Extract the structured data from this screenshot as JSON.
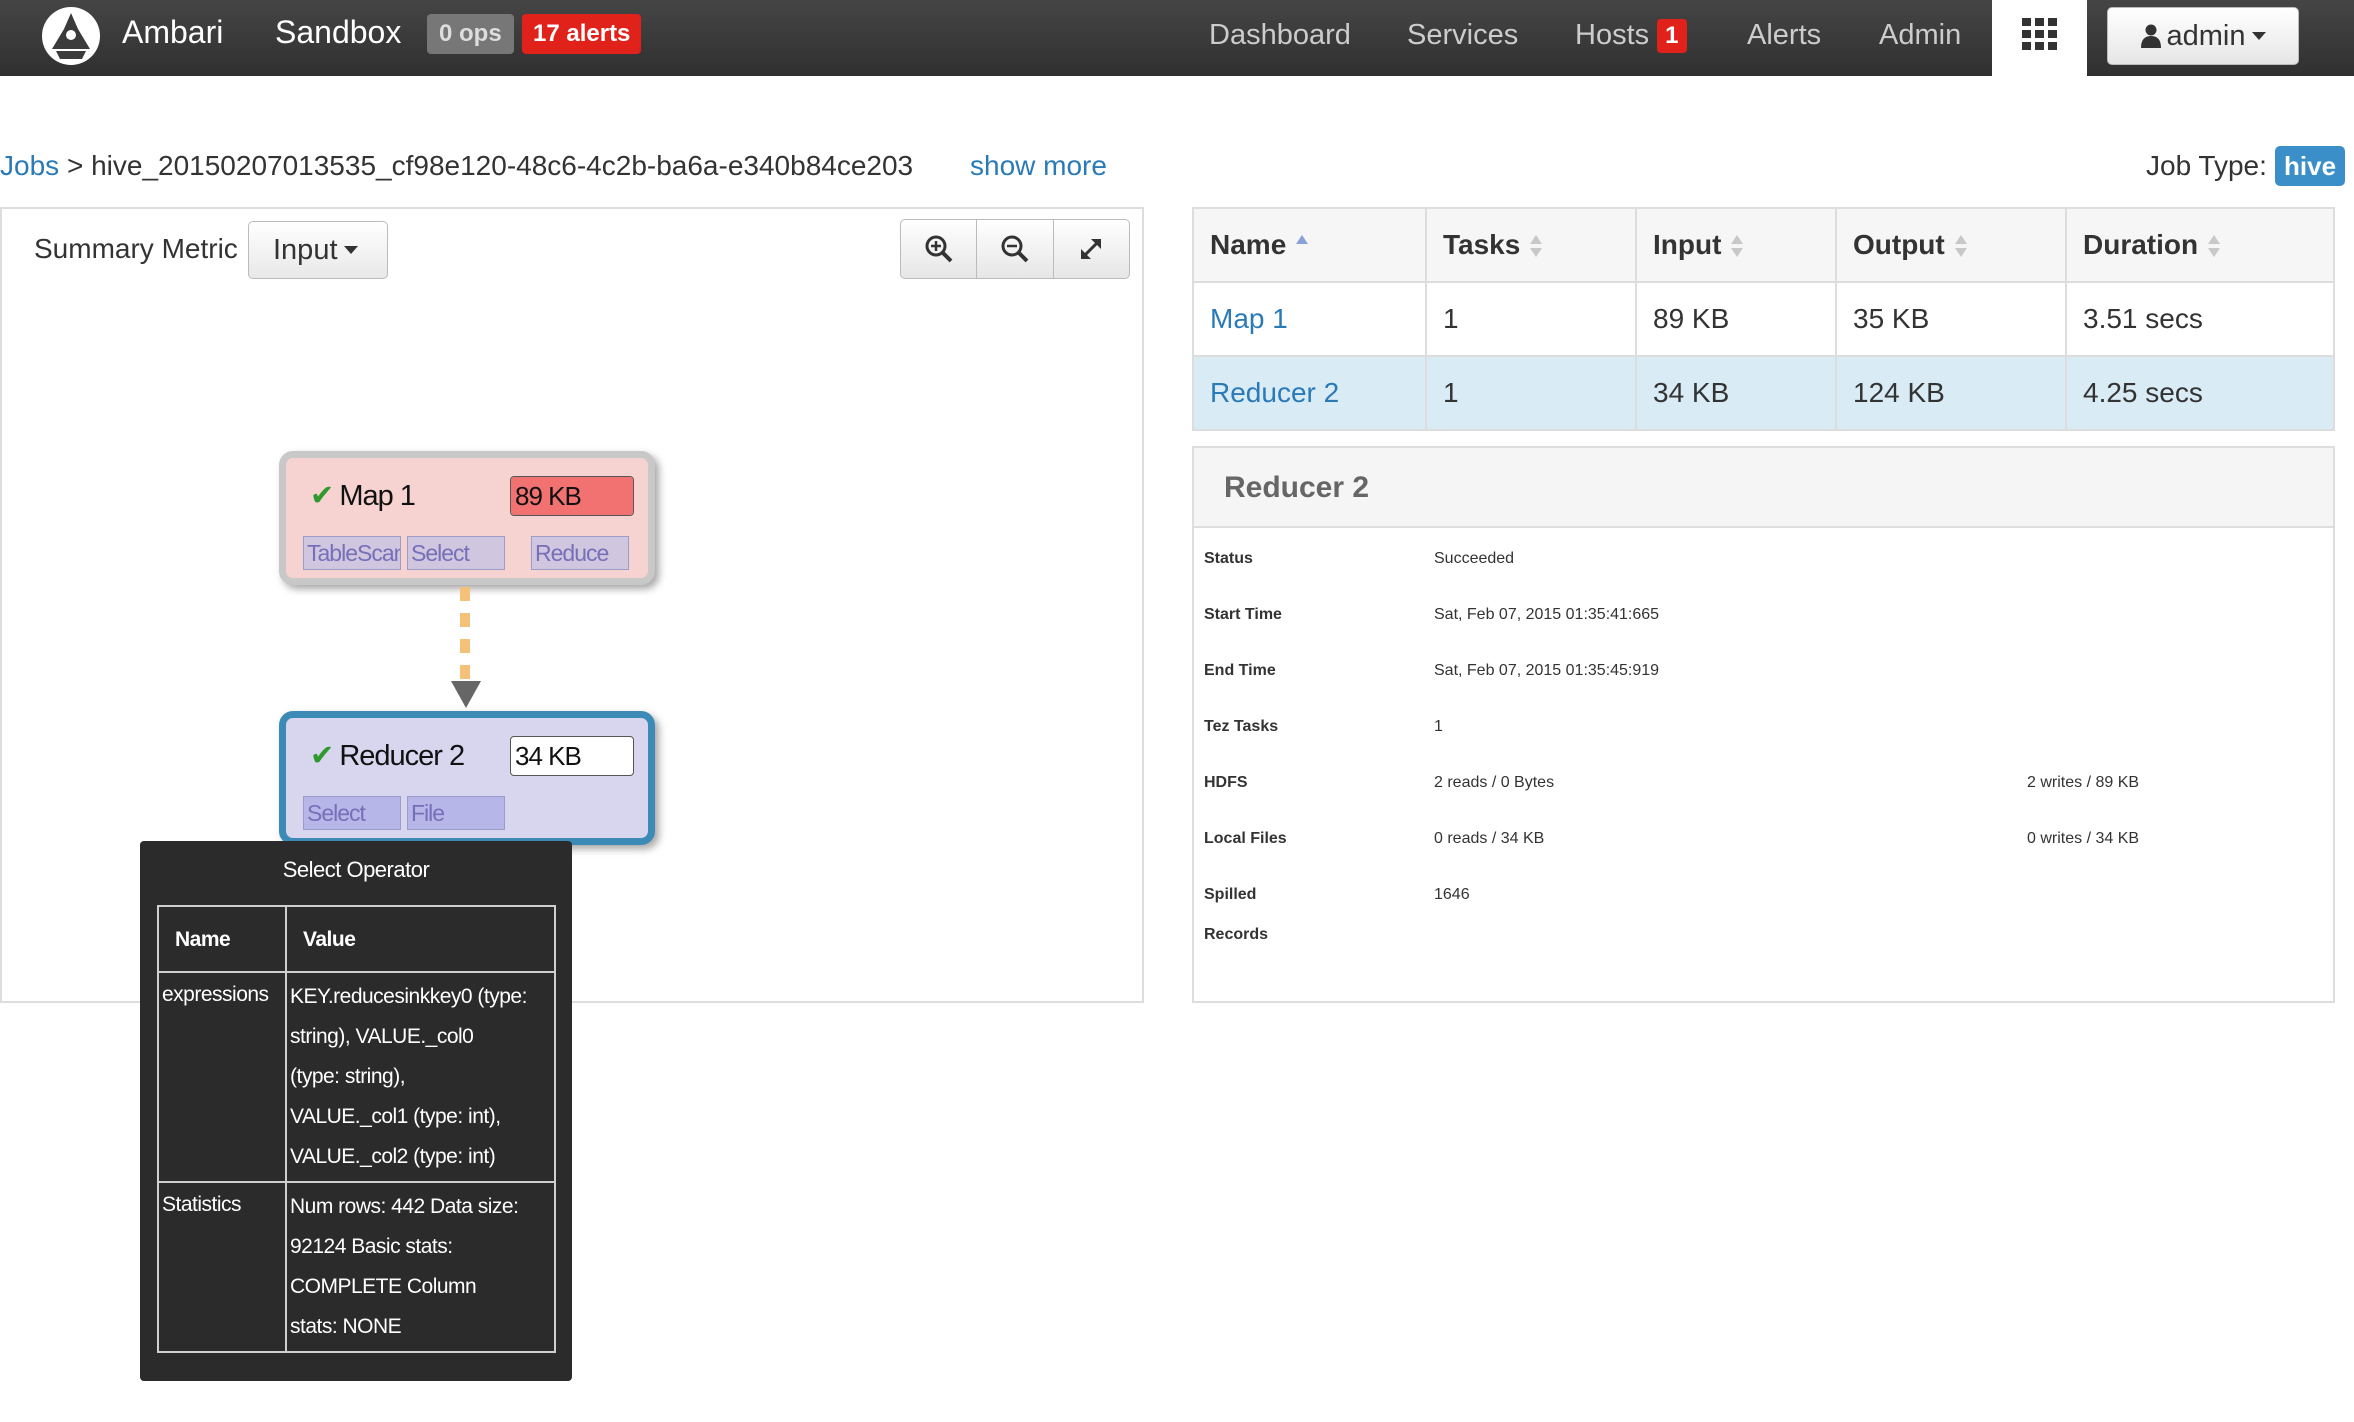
{
  "navbar": {
    "brand": "Ambari",
    "cluster": "Sandbox",
    "ops_badge": "0 ops",
    "alerts_badge": "17 alerts",
    "items": [
      {
        "label": "Dashboard"
      },
      {
        "label": "Services"
      },
      {
        "label": "Hosts",
        "badge": "1"
      },
      {
        "label": "Alerts"
      },
      {
        "label": "Admin"
      }
    ],
    "user_label": "admin",
    "icons": [
      "ambari-logo-icon",
      "apps-grid-icon",
      "user-icon",
      "caret-down-icon"
    ]
  },
  "breadcrumb": {
    "root": "Jobs",
    "separator": ">",
    "job_id": "hive_20150207013535_cf98e120-48c6-4c2b-ba6a-e340b84ce203",
    "show_more": "show more",
    "job_type_label": "Job Type:",
    "job_type": "hive"
  },
  "graph": {
    "summary_label": "Summary Metric",
    "metric_select": "Input",
    "toolbar_icons": [
      "zoom-in-icon",
      "zoom-out-icon",
      "expand-icon"
    ],
    "nodes": [
      {
        "name": "Map 1",
        "metric": "89 KB",
        "metric_fraction": 1.0,
        "operators": [
          "TableScan",
          "Select",
          "Reduce"
        ],
        "status_icon": "check-icon"
      },
      {
        "name": "Reducer 2",
        "metric": "34 KB",
        "metric_fraction": 0.0,
        "operators": [
          "Select",
          "File"
        ],
        "status_icon": "check-icon"
      }
    ],
    "colors": {
      "map_node": "#f6d2d0",
      "reducer_node": "#d8d6ee",
      "selected_border": "#3c8ab6",
      "edge": "#f5c078"
    }
  },
  "tooltip": {
    "title": "Select Operator",
    "headers": [
      "Name",
      "Value"
    ],
    "rows": [
      {
        "name": "expressions",
        "value_lines": [
          "KEY.reducesinkkey0 (type:",
          "string), VALUE._col0",
          "(type: string),",
          "VALUE._col1 (type: int),",
          "VALUE._col2 (type: int)"
        ]
      },
      {
        "name": "Statistics",
        "value_lines": [
          "Num rows: 442 Data size:",
          "92124 Basic stats:",
          "COMPLETE Column",
          "stats: NONE"
        ]
      }
    ]
  },
  "vertices": {
    "headers": [
      "Name",
      "Tasks",
      "Input",
      "Output",
      "Duration"
    ],
    "rows": [
      {
        "name": "Map 1",
        "tasks": "1",
        "input": "89 KB",
        "output": "35 KB",
        "duration": "3.51 secs"
      },
      {
        "name": "Reducer 2",
        "tasks": "1",
        "input": "34 KB",
        "output": "124 KB",
        "duration": "4.25 secs"
      }
    ]
  },
  "details": {
    "title": "Reducer 2",
    "status_label": "Status",
    "status": "Succeeded",
    "start_label": "Start Time",
    "start": "Sat, Feb 07, 2015 01:35:41:665",
    "end_label": "End Time",
    "end": "Sat, Feb 07, 2015 01:35:45:919",
    "tez_label": "Tez Tasks",
    "tez": "1",
    "hdfs_label": "HDFS",
    "hdfs_reads": "2 reads / 0 Bytes",
    "hdfs_writes": "2 writes / 89 KB",
    "local_label": "Local Files",
    "local_reads": "0 reads / 34 KB",
    "local_writes": "0 writes / 34 KB",
    "spilled_label_1": "Spilled",
    "spilled_label_2": "Records",
    "spilled": "1646"
  }
}
